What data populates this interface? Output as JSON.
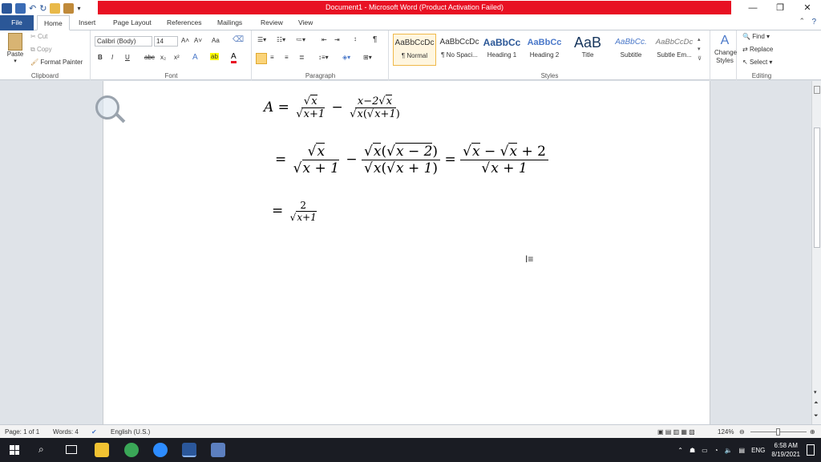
{
  "window": {
    "title": "Document1 - Microsoft Word (Product Activation Failed)",
    "minimize": "—",
    "maximize": "❐",
    "close": "✕"
  },
  "tabs": [
    "File",
    "Home",
    "Insert",
    "Page Layout",
    "References",
    "Mailings",
    "Review",
    "View"
  ],
  "clipboard": {
    "paste": "Paste",
    "cut": "Cut",
    "copy": "Copy",
    "format_painter": "Format Painter",
    "label": "Clipboard"
  },
  "font": {
    "family": "Calibri (Body)",
    "size": "14",
    "label": "Font",
    "bold": "B",
    "italic": "I",
    "underline": "U",
    "strike": "abc",
    "subscript": "x₂",
    "superscript": "x²",
    "grow": "A˄",
    "shrink": "A˅",
    "case": "Aa",
    "effects": "A",
    "highlight": "ab",
    "color": "A"
  },
  "paragraph": {
    "label": "Paragraph",
    "pilcrow": "¶"
  },
  "styles": {
    "label": "Styles",
    "tiles": [
      {
        "preview": "AaBbCcDc",
        "name": "¶ Normal"
      },
      {
        "preview": "AaBbCcDc",
        "name": "¶ No Spaci..."
      },
      {
        "preview": "AaBbCc",
        "name": "Heading 1"
      },
      {
        "preview": "AaBbCc",
        "name": "Heading 2"
      },
      {
        "preview": "AaB",
        "name": "Title"
      },
      {
        "preview": "AaBbCc.",
        "name": "Subtitle"
      },
      {
        "preview": "AaBbCcDc",
        "name": "Subtle Em..."
      }
    ],
    "change_styles": "Change Styles"
  },
  "editing": {
    "label": "Editing",
    "find": "Find",
    "replace": "Replace",
    "select": "Select"
  },
  "document": {
    "line1": {
      "lhs": "A =",
      "f1_num": "x",
      "f1_den": "x+1",
      "minus": "−",
      "f2_num_a": "x−2",
      "f2_num_b": "x",
      "f2_den_a": "x",
      "f2_den_b": "x+1"
    },
    "line2": {
      "eq": "=",
      "f1_num": "x",
      "f1_den": "x + 1",
      "minus": "−",
      "f2_num": "x − 2",
      "f2_den": "x + 1",
      "eq2": "=",
      "f3_num_a": "x",
      "f3_num_mid": "−",
      "f3_num_b": "x",
      "f3_num_c": "+ 2",
      "f3_den": "x + 1"
    },
    "line3": {
      "eq": "=",
      "num": "2",
      "den": "x+1"
    }
  },
  "status": {
    "page": "Page: 1 of 1",
    "words": "Words: 4",
    "language": "English (U.S.)",
    "zoom": "124%"
  },
  "taskbar": {
    "lang": "ENG",
    "time": "6:58 AM",
    "date": "8/19/2021"
  },
  "colors": {
    "title_red": "#e81123",
    "file_tab": "#2b5797",
    "taskbar": "#1a1c23"
  }
}
